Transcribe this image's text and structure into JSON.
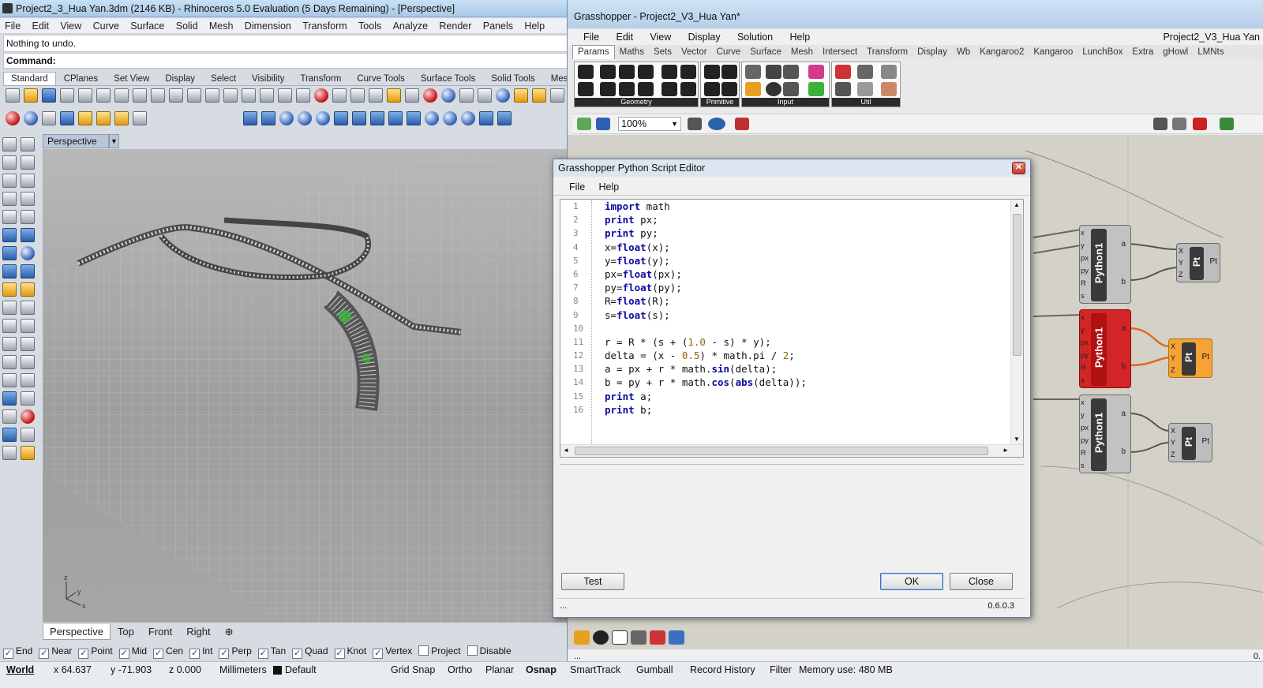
{
  "rhino": {
    "title": "Project2_3_Hua Yan.3dm (2146 KB) - Rhinoceros 5.0 Evaluation (5 Days Remaining) - [Perspective]",
    "menu": [
      "File",
      "Edit",
      "View",
      "Curve",
      "Surface",
      "Solid",
      "Mesh",
      "Dimension",
      "Transform",
      "Tools",
      "Analyze",
      "Render",
      "Panels",
      "Help"
    ],
    "history": "Nothing to undo.",
    "command_label": "Command:",
    "toolbar_tabs": [
      "Standard",
      "CPlanes",
      "Set View",
      "Display",
      "Select",
      "Visibility",
      "Transform",
      "Curve Tools",
      "Surface Tools",
      "Solid Tools",
      "Mesh To"
    ],
    "viewport_label": "Perspective",
    "viewport_tabs": [
      "Perspective",
      "Top",
      "Front",
      "Right"
    ],
    "axes": {
      "x": "x",
      "y": "y",
      "z": "z"
    },
    "osnaps": [
      {
        "label": "End",
        "checked": true
      },
      {
        "label": "Near",
        "checked": true
      },
      {
        "label": "Point",
        "checked": true
      },
      {
        "label": "Mid",
        "checked": true
      },
      {
        "label": "Cen",
        "checked": true
      },
      {
        "label": "Int",
        "checked": true
      },
      {
        "label": "Perp",
        "checked": true
      },
      {
        "label": "Tan",
        "checked": true
      },
      {
        "label": "Quad",
        "checked": true
      },
      {
        "label": "Knot",
        "checked": true
      },
      {
        "label": "Vertex",
        "checked": true
      },
      {
        "label": "Project",
        "checked": false
      },
      {
        "label": "Disable",
        "checked": false
      }
    ],
    "status": {
      "world": "World",
      "x": "x 64.637",
      "y": "y -71.903",
      "z": "z 0.000",
      "units": "Millimeters",
      "layer": "Default",
      "grid_snap": "Grid Snap",
      "ortho": "Ortho",
      "planar": "Planar",
      "osnap": "Osnap",
      "smart_track": "SmartTrack",
      "gumball": "Gumball",
      "record_history": "Record History",
      "filter": "Filter",
      "memory": "Memory use: 480 MB"
    }
  },
  "grasshopper": {
    "title": "Grasshopper - Project2_V3_Hua Yan*",
    "menu": [
      "File",
      "Edit",
      "View",
      "Display",
      "Solution",
      "Help"
    ],
    "project": "Project2_V3_Hua Yan",
    "tabs": [
      "Params",
      "Maths",
      "Sets",
      "Vector",
      "Curve",
      "Surface",
      "Mesh",
      "Intersect",
      "Transform",
      "Display",
      "Wb",
      "Kangaroo2",
      "Kangaroo",
      "LunchBox",
      "Extra",
      "gHowl",
      "LMNts"
    ],
    "groups": [
      "Geometry",
      "Primitive",
      "Input",
      "Util"
    ],
    "zoom": "100%",
    "components": {
      "python_name": "Python1",
      "python_inputs": [
        "x",
        "y",
        "px",
        "py",
        "R",
        "s"
      ],
      "python_outputs": [
        "a",
        "b"
      ],
      "pt_name": "Pt",
      "pt_inputs": [
        "X",
        "Y",
        "Z"
      ],
      "pt_output": "Pt"
    },
    "foot": "...",
    "foot_right": "0."
  },
  "python_editor": {
    "title": "Grasshopper Python Script Editor",
    "menu": [
      "File",
      "Help"
    ],
    "code_lines": [
      "import math",
      "print px;",
      "print py;",
      "x=float(x);",
      "y=float(y);",
      "px=float(px);",
      "py=float(py);",
      "R=float(R);",
      "s=float(s);",
      "",
      "r = R * (s + (1.0 - s) * y);",
      "delta = (x - 0.5) * math.pi / 2;",
      "a = px + r * math.sin(delta);",
      "b = py + r * math.cos(abs(delta));",
      "print a;",
      "print b;"
    ],
    "test_label": "Test",
    "ok_label": "OK",
    "close_label": "Close",
    "version": "0.6.0.3",
    "foot": "..."
  }
}
